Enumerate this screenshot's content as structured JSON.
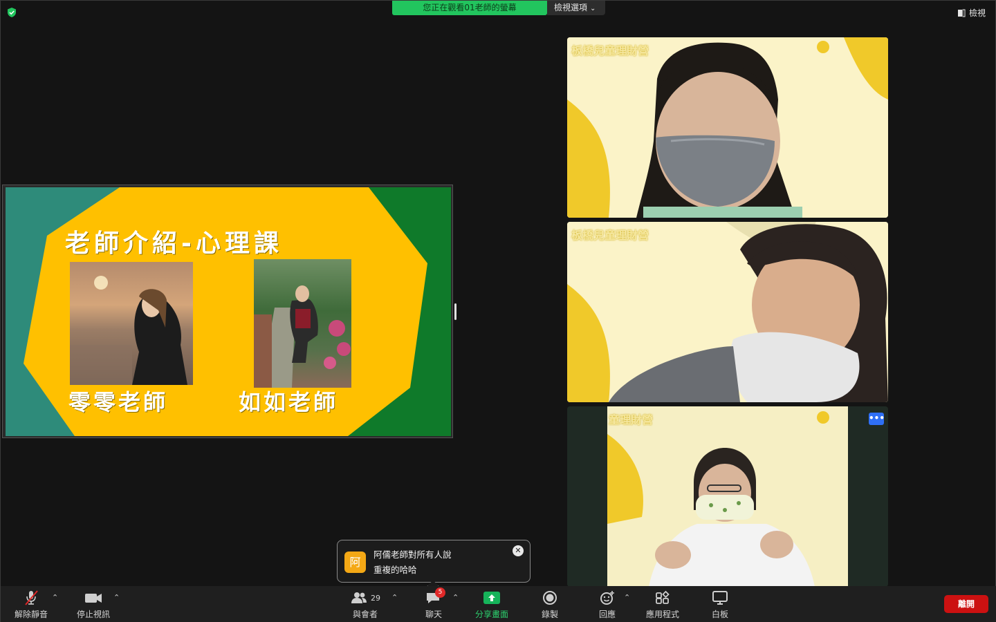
{
  "top": {
    "banner": "您正在觀看01老師的螢幕",
    "view_options": "檢視選項",
    "view_label": "檢視"
  },
  "slide": {
    "title": "老師介紹-心理課",
    "teacher1": "零零老師",
    "teacher2": "如如老師"
  },
  "videos": [
    {
      "watermark": "板橋兒童理財營"
    },
    {
      "watermark": "板橋兒童理財營"
    },
    {
      "watermark": "童理財營"
    }
  ],
  "chat_toast": {
    "avatar": "阿",
    "sender_line": "阿儒老師對所有人說",
    "message": "重複的哈哈"
  },
  "toolbar": {
    "unmute": "解除靜音",
    "stop_video": "停止視訊",
    "participants": "與會者",
    "participants_count": "29",
    "chat": "聊天",
    "chat_badge": "5",
    "share": "分享畫面",
    "record": "錄製",
    "reactions": "回應",
    "apps": "應用程式",
    "whiteboard": "白板",
    "leave": "離開"
  },
  "colors": {
    "banner_green": "#22c55e",
    "slide_green": "#0f7a2a",
    "slide_teal": "#2e8b7a",
    "slide_yellow": "#ffc000",
    "leave_red": "#cc1111",
    "accent_blue": "#2f6ff5"
  }
}
